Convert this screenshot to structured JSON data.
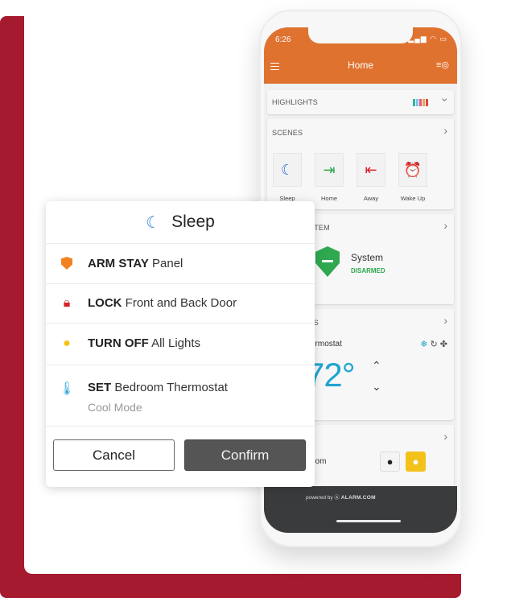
{
  "colors": {
    "brand_red": "#a61a2f",
    "app_orange": "#e07230",
    "disarmed_green": "#2fa84f",
    "temp_blue": "#1ea5cf",
    "confirm_gray": "#555555"
  },
  "phone": {
    "status_time": "6:26",
    "status_icons": "signal-icon wifi-icon battery-icon",
    "app_title": "Home",
    "highlights": {
      "title": "HIGHLIGHTS",
      "bar_colors": [
        "#2bb5a0",
        "#7cc4e8",
        "#e8577a",
        "#f0a35e",
        "#d64a4a"
      ]
    },
    "scenes": {
      "title": "SCENES",
      "items": [
        {
          "label": "Sleep",
          "icon": "moon-icon",
          "glyph": "☾",
          "color": "#2b6fd9"
        },
        {
          "label": "Home",
          "icon": "home-arrive-icon",
          "glyph": "⇥",
          "color": "#2fa84f"
        },
        {
          "label": "Away",
          "icon": "home-leave-icon",
          "glyph": "⇤",
          "color": "#d6202a"
        },
        {
          "label": "Wake Up",
          "icon": "alarm-clock-icon",
          "glyph": "⏰",
          "color": "#f2c21b"
        }
      ]
    },
    "security": {
      "title_partial": "STEM",
      "name": "System",
      "status": "DISARMED"
    },
    "thermostats": {
      "title_partial": "TS",
      "name_partial": "ermostat",
      "temperature": "72°",
      "mode_icons": {
        "snow": "❄",
        "auto": "↻",
        "fan": "✤"
      }
    },
    "lights": {
      "name_partial": "oom"
    },
    "footer": {
      "powered_by": "powered by",
      "brand": "ALARM.COM"
    }
  },
  "modal": {
    "title": "Sleep",
    "actions": [
      {
        "icon": "shield-icon",
        "verb": "ARM STAY",
        "object": "Panel",
        "sub": ""
      },
      {
        "icon": "lock-icon",
        "verb": "LOCK",
        "object": "Front and Back Door",
        "sub": ""
      },
      {
        "icon": "lightbulb-icon",
        "verb": "TURN OFF",
        "object": "All Lights",
        "sub": ""
      },
      {
        "icon": "thermostat-icon",
        "verb": "SET",
        "object": "Bedroom Thermostat",
        "sub": "Cool Mode"
      }
    ],
    "cancel_label": "Cancel",
    "confirm_label": "Confirm"
  }
}
